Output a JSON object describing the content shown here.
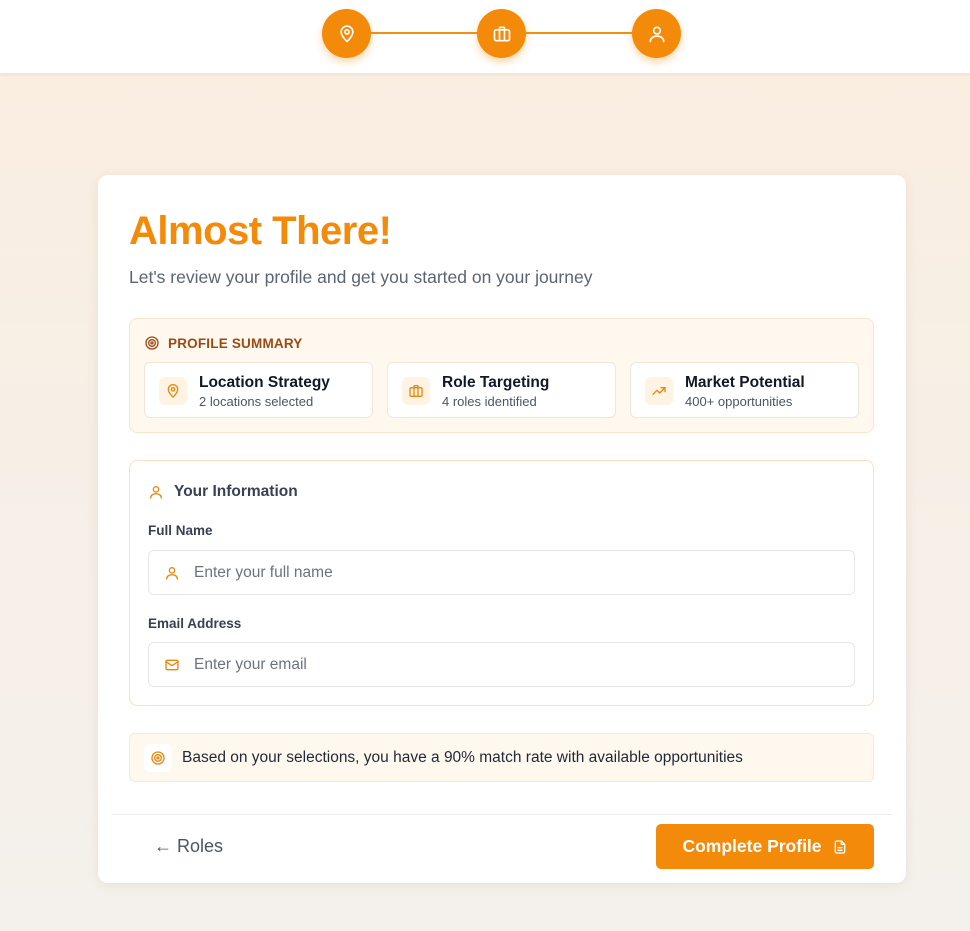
{
  "stepper": {
    "steps": [
      {
        "icon": "map-pin-icon"
      },
      {
        "icon": "briefcase-icon"
      },
      {
        "icon": "user-icon"
      }
    ],
    "accent": "#f38a0a"
  },
  "card": {
    "title": "Almost There!",
    "subtitle": "Let's review your profile and get you started on your journey"
  },
  "summary": {
    "heading": "PROFILE SUMMARY",
    "items": [
      {
        "icon": "map-pin-icon",
        "title": "Location Strategy",
        "subtitle": "2 locations selected"
      },
      {
        "icon": "briefcase-icon",
        "title": "Role Targeting",
        "subtitle": "4 roles identified"
      },
      {
        "icon": "trending-up-icon",
        "title": "Market Potential",
        "subtitle": "400+ opportunities"
      }
    ]
  },
  "info": {
    "heading": "Your Information",
    "full_name": {
      "label": "Full Name",
      "placeholder": "Enter your full name",
      "value": ""
    },
    "email": {
      "label": "Email Address",
      "placeholder": "Enter your email",
      "value": ""
    }
  },
  "match": {
    "text": "Based on your selections, you have a 90% match rate with available opportunities"
  },
  "footer": {
    "back_label": "← Roles",
    "complete_label": "Complete Profile"
  }
}
